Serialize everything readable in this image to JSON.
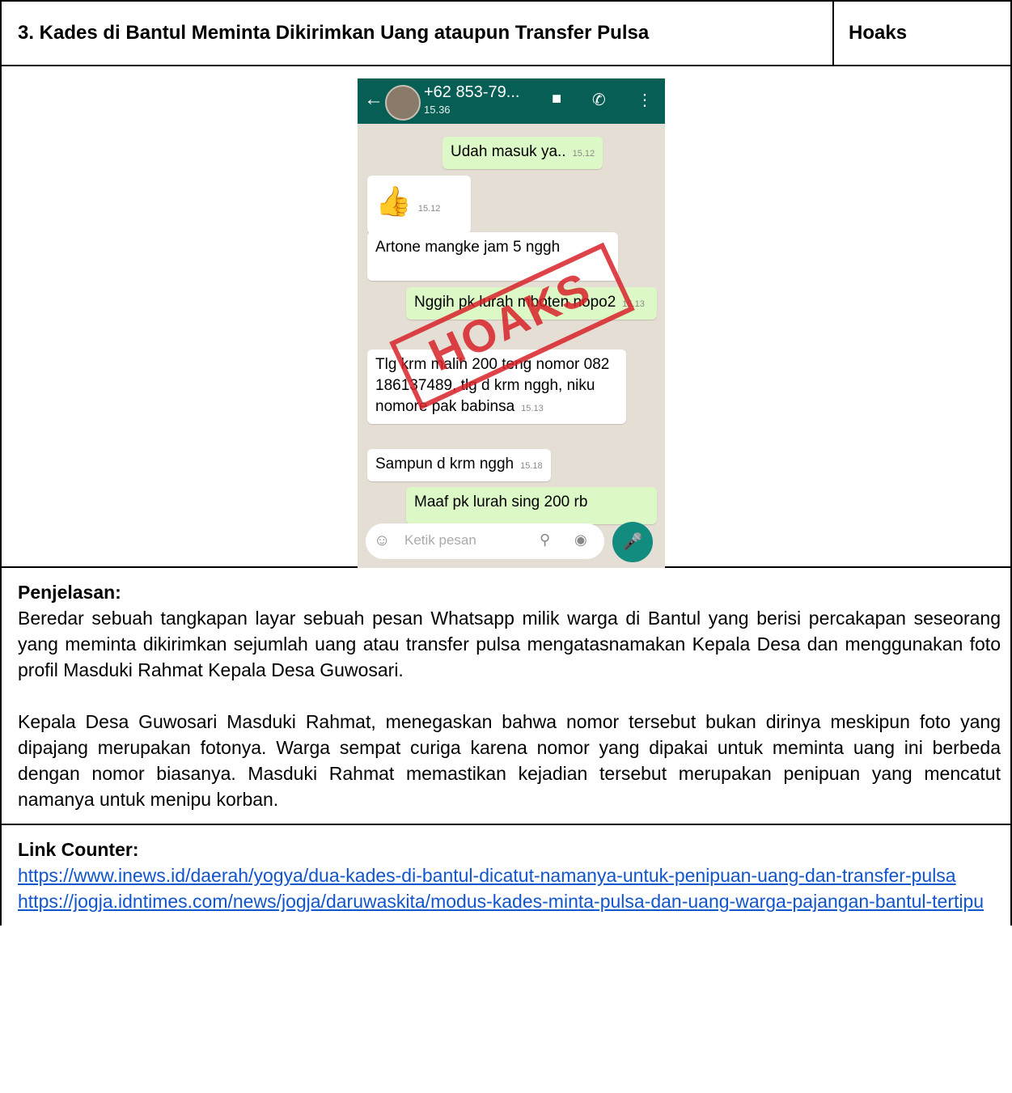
{
  "header": {
    "title": "3. Kades di Bantul Meminta Dikirimkan Uang ataupun Transfer Pulsa",
    "verdict": "Hoaks"
  },
  "screenshot": {
    "contact": "+62 853-79...",
    "last_seen": "15.36",
    "messages": [
      {
        "text": "Udah masuk ya..",
        "time": "15.12",
        "direction": "out"
      },
      {
        "text": "👍",
        "time": "15.12",
        "direction": "in"
      },
      {
        "text": "Artone mangke jam 5 nggh",
        "time": "",
        "direction": "in"
      },
      {
        "text": "Nggih pk lurah mboten nopo2",
        "time": "15.13",
        "direction": "out"
      },
      {
        "text": "Tlg krm malih 200 teng nomor 082 186137489, tlg d krm nggh, niku nomore pak babinsa",
        "time": "15.13",
        "direction": "in"
      },
      {
        "text": "Sampun d krm nggh",
        "time": "15.18",
        "direction": "in"
      },
      {
        "text": "Maaf pk lurah sing 200 rb",
        "time": "",
        "direction": "out"
      }
    ],
    "stamp": "HOAKS",
    "input_placeholder": "Ketik pesan",
    "icons": [
      "back-arrow-icon",
      "video-call-icon",
      "phone-icon",
      "more-icon",
      "emoji-icon",
      "attach-icon",
      "camera-icon",
      "mic-icon"
    ]
  },
  "explanation": {
    "heading": "Penjelasan:",
    "p1": "Beredar sebuah tangkapan layar sebuah pesan Whatsapp milik warga di Bantul yang berisi percakapan seseorang yang meminta dikirimkan sejumlah uang atau transfer pulsa mengatasnamakan Kepala Desa dan menggunakan foto profil Masduki Rahmat Kepala Desa Guwosari.",
    "p2": "Kepala Desa Guwosari Masduki Rahmat, menegaskan bahwa nomor tersebut bukan dirinya meskipun foto yang dipajang merupakan fotonya. Warga sempat curiga karena nomor yang dipakai untuk meminta uang ini berbeda dengan nomor biasanya. Masduki Rahmat memastikan kejadian tersebut merupakan penipuan yang mencatut namanya untuk menipu korban."
  },
  "links": {
    "heading": "Link Counter:",
    "link1": "https://www.inews.id/daerah/yogya/dua-kades-di-bantul-dicatut-namanya-untuk-penipuan-uang-dan-transfer-pulsa",
    "link2": "https://jogja.idntimes.com/news/jogja/daruwaskita/modus-kades-minta-pulsa-dan-uang-warga-pajangan-bantul-tertipu"
  },
  "colors": {
    "link": "#1155cc",
    "wa_header": "#075e54",
    "wa_out_bubble": "#dcf8c6",
    "stamp": "#d8232a"
  }
}
